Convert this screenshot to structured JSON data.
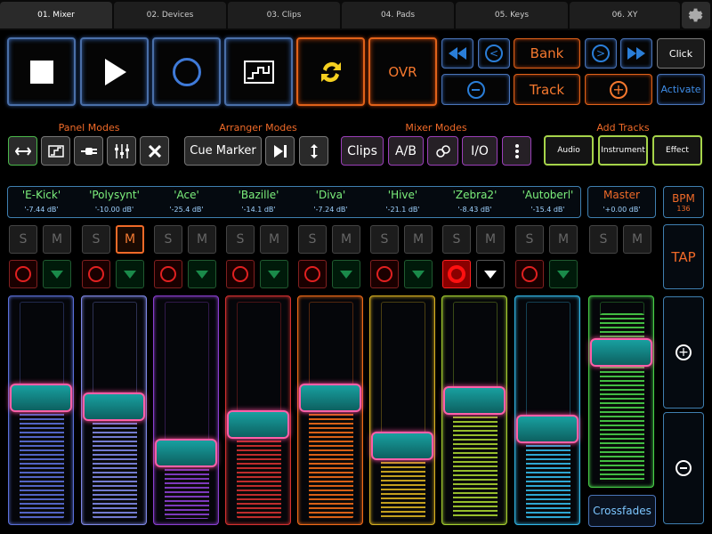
{
  "tabs": [
    "01. Mixer",
    "02. Devices",
    "03. Clips",
    "04. Pads",
    "05. Keys",
    "06. XY"
  ],
  "transport": {
    "ovr_label": "OVR",
    "bank_label": "Bank",
    "track_label": "Track",
    "click_label": "Click",
    "activate_label": "Activate"
  },
  "sections": {
    "panel_modes": "Panel Modes",
    "arranger_modes": "Arranger Modes",
    "mixer_modes": "Mixer Modes",
    "add_tracks": "Add Tracks"
  },
  "arranger": {
    "cue_marker": "Cue Marker"
  },
  "mixer_modes": {
    "clips": "Clips",
    "ab": "A/B",
    "io": "I/O"
  },
  "add_tracks": {
    "audio": "Audio",
    "instrument": "Instrument",
    "effect": "Effect"
  },
  "tracks": [
    {
      "name": "'E-Kick'",
      "db": "'-7.44 dB'",
      "color": "#5a6fd8",
      "level": 0.56,
      "mute": false,
      "rec": false,
      "mon": true
    },
    {
      "name": "'Polysynt'",
      "db": "'-10.00 dB'",
      "color": "#7f88e6",
      "level": 0.52,
      "mute": true,
      "rec": false,
      "mon": true
    },
    {
      "name": "'Ace'",
      "db": "'-25.4 dB'",
      "color": "#8a3fd0",
      "level": 0.31,
      "mute": false,
      "rec": false,
      "mon": true
    },
    {
      "name": "'Bazille'",
      "db": "'-14.1 dB'",
      "color": "#d43030",
      "level": 0.44,
      "mute": false,
      "rec": false,
      "mon": true
    },
    {
      "name": "'Diva'",
      "db": "'-7.24 dB'",
      "color": "#f06a18",
      "level": 0.56,
      "mute": false,
      "rec": false,
      "mon": true
    },
    {
      "name": "'Hive'",
      "db": "'-21.1 dB'",
      "color": "#d8b020",
      "level": 0.34,
      "mute": false,
      "rec": false,
      "mon": true
    },
    {
      "name": "'Zebra2'",
      "db": "'-8.43 dB'",
      "color": "#a6d030",
      "level": 0.55,
      "mute": false,
      "rec": true,
      "mon": false
    },
    {
      "name": "'Autoberl'",
      "db": "'-15.4 dB'",
      "color": "#32b8e8",
      "level": 0.42,
      "mute": false,
      "rec": false,
      "mon": true
    }
  ],
  "master": {
    "name": "Master",
    "db": "'+0.00 dB'",
    "color": "#48d048",
    "level": 0.77
  },
  "solo_label": "S",
  "mute_label": "M",
  "bpm": {
    "label": "BPM",
    "value": "136"
  },
  "tap_label": "TAP",
  "crossfades_label": "Crossfades",
  "colors": {
    "accent": "#f06a28",
    "blue": "#4a74b8",
    "knob": "#ff5fa8"
  }
}
